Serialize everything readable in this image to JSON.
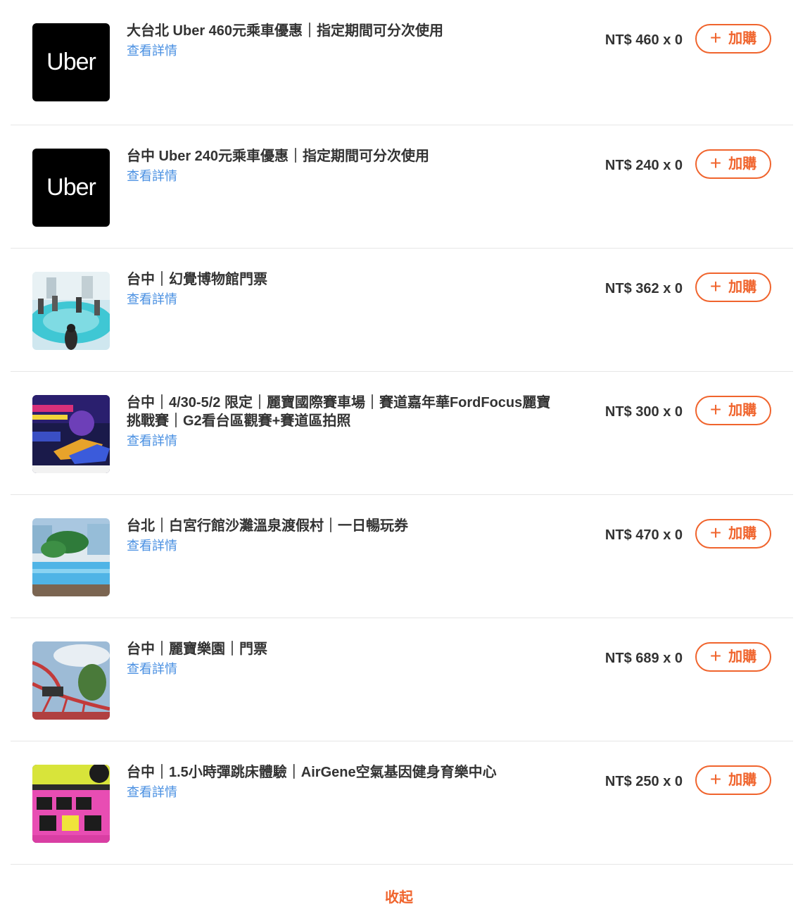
{
  "detail_label": "查看詳情",
  "add_label": "加購",
  "collapse_label": "收起",
  "uber_logo_text": "Uber",
  "accent_color": "#f0642d",
  "link_color": "#4a90e2",
  "items": [
    {
      "title": "大台北 Uber 460元乘車優惠｜指定期間可分次使用",
      "price": "NT$ 460 x 0",
      "image": "uber-logo"
    },
    {
      "title": "台中 Uber 240元乘車優惠｜指定期間可分次使用",
      "price": "NT$ 240 x 0",
      "image": "uber-logo"
    },
    {
      "title": "台中｜幻覺博物館門票",
      "price": "NT$ 362 x 0",
      "image": "illusion-museum-photo"
    },
    {
      "title": "台中｜4/30-5/2 限定｜麗寶國際賽車場｜賽道嘉年華FordFocus麗寶挑戰賽｜G2看台區觀賽+賽道區拍照",
      "price": "NT$ 300 x 0",
      "image": "race-carnival-poster"
    },
    {
      "title": "台北｜白宮行館沙灘溫泉渡假村｜一日暢玩券",
      "price": "NT$ 470 x 0",
      "image": "resort-pool-photo"
    },
    {
      "title": "台中｜麗寶樂園｜門票",
      "price": "NT$ 689 x 0",
      "image": "roller-coaster-photo"
    },
    {
      "title": "台中｜1.5小時彈跳床體驗｜AirGene空氣基因健身育樂中心",
      "price": "NT$ 250 x 0",
      "image": "trampoline-park-photo"
    }
  ]
}
